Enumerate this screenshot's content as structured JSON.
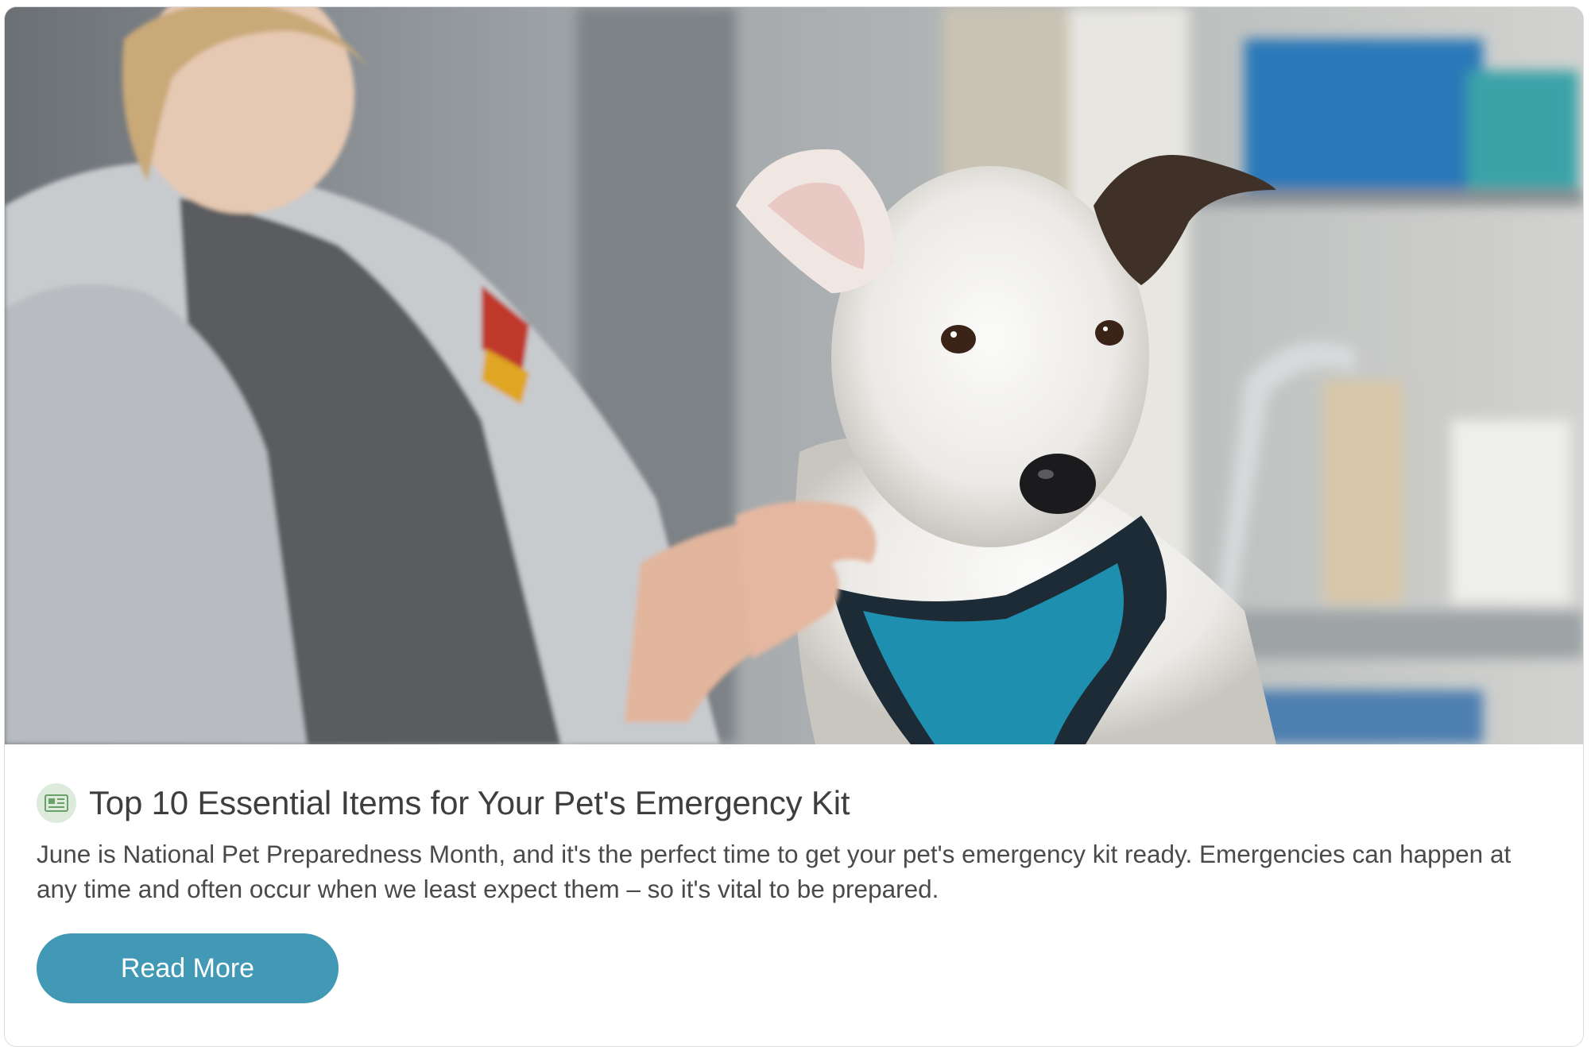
{
  "card": {
    "image_alt": "Staff member holding a white terrier puppy wearing a teal harness",
    "icon": "article-icon",
    "title": "Top 10 Essential Items for Your Pet's Emergency Kit",
    "summary": "June is National Pet Preparedness Month, and it's the perfect time to get your pet's emergency kit ready. Emergencies can happen at any time and often occur when we least expect them – so it's vital to be prepared.",
    "button_label": "Read More"
  },
  "colors": {
    "accent": "#4299b6",
    "icon_bg": "#dcebdc",
    "icon_fg": "#6aa06a",
    "title": "#3e3e3e",
    "text": "#4a4a4a"
  }
}
